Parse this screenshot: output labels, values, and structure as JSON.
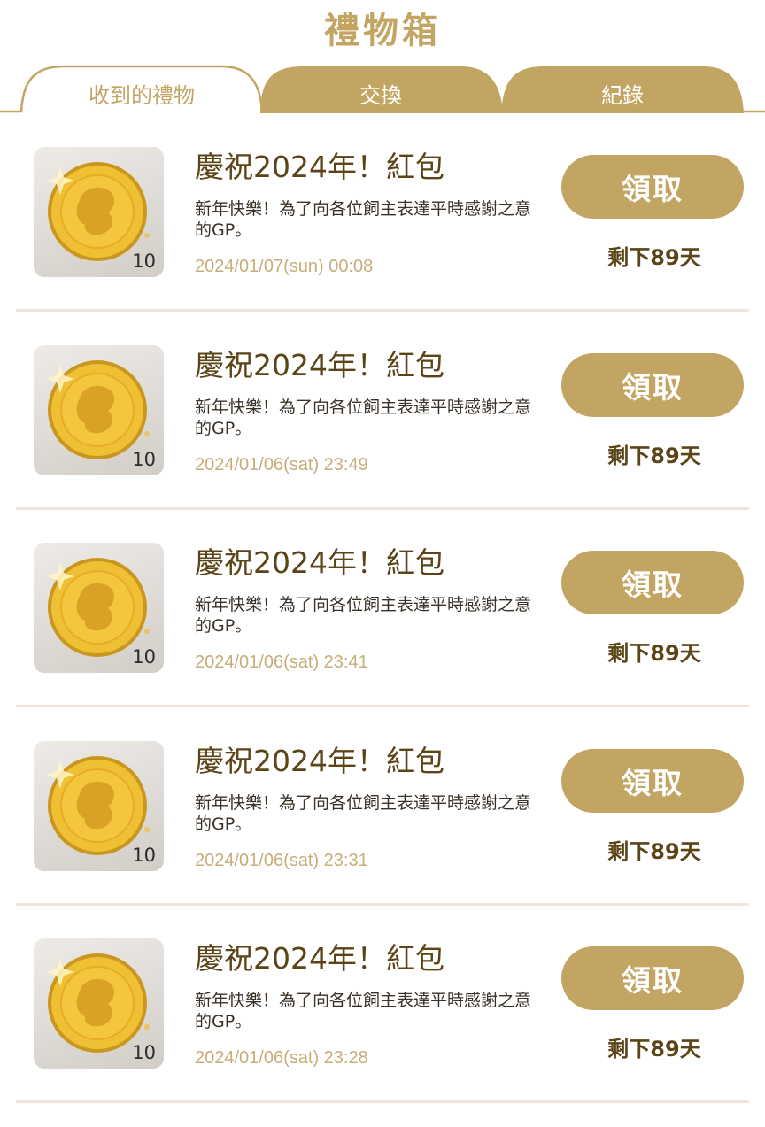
{
  "header": {
    "title": "禮物箱"
  },
  "tabs": [
    {
      "label": "收到的禮物",
      "active": true
    },
    {
      "label": "交換",
      "active": false
    },
    {
      "label": "紀錄",
      "active": false
    }
  ],
  "colors": {
    "accent": "#c3a563",
    "title_text": "#5b4416",
    "date_text": "#c7ad78",
    "divider": "#efe4da"
  },
  "gifts": [
    {
      "icon": "gold-coin-icon",
      "quantity": "10",
      "title": "慶祝2024年！紅包",
      "description": "新年快樂！為了向各位飼主表達平時感謝之意的GP。",
      "date": "2024/01/07(sun) 00:08",
      "button_label": "領取",
      "remaining": "剩下89天"
    },
    {
      "icon": "gold-coin-icon",
      "quantity": "10",
      "title": "慶祝2024年！紅包",
      "description": "新年快樂！為了向各位飼主表達平時感謝之意的GP。",
      "date": "2024/01/06(sat) 23:49",
      "button_label": "領取",
      "remaining": "剩下89天"
    },
    {
      "icon": "gold-coin-icon",
      "quantity": "10",
      "title": "慶祝2024年！紅包",
      "description": "新年快樂！為了向各位飼主表達平時感謝之意的GP。",
      "date": "2024/01/06(sat) 23:41",
      "button_label": "領取",
      "remaining": "剩下89天"
    },
    {
      "icon": "gold-coin-icon",
      "quantity": "10",
      "title": "慶祝2024年！紅包",
      "description": "新年快樂！為了向各位飼主表達平時感謝之意的GP。",
      "date": "2024/01/06(sat) 23:31",
      "button_label": "領取",
      "remaining": "剩下89天"
    },
    {
      "icon": "gold-coin-icon",
      "quantity": "10",
      "title": "慶祝2024年！紅包",
      "description": "新年快樂！為了向各位飼主表達平時感謝之意的GP。",
      "date": "2024/01/06(sat) 23:28",
      "button_label": "領取",
      "remaining": "剩下89天"
    }
  ]
}
